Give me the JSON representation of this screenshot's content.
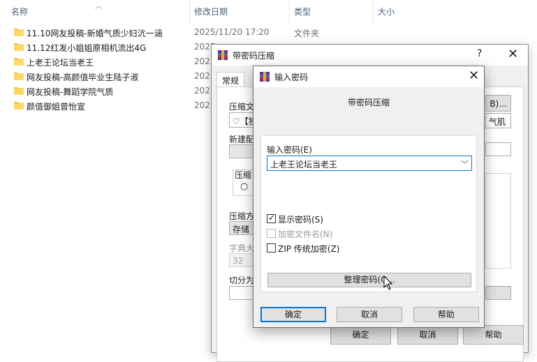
{
  "explorer": {
    "columns": {
      "name": "名称",
      "modified": "修改日期",
      "type": "类型",
      "size": "大小"
    },
    "rows": [
      {
        "name": "11.10网友投稿-新婚气质少妇沆一涵",
        "date": "2025/11/20 17:20",
        "type": "文件夹"
      },
      {
        "name": "11.12红发小姐姐原相机流出4G",
        "date": "2025",
        "type": ""
      },
      {
        "name": "上老王论坛当老王",
        "date": "2025",
        "type": ""
      },
      {
        "name": "网友投稿-高颜值毕业生陆子淑",
        "date": "2025",
        "type": ""
      },
      {
        "name": "网友投稿-舞蹈学院气质",
        "date": "2025",
        "type": ""
      },
      {
        "name": "颜值御姐曾怡宣",
        "date": "2025",
        "type": ""
      }
    ],
    "folder_color": "#f5c542"
  },
  "back_dialog": {
    "title": "带密码压缩",
    "help_glyph": "?",
    "close_glyph": "✕",
    "tabs": [
      "常规"
    ],
    "archive_label": "压缩文",
    "archive_value": "♡【独",
    "browse_label": "B)...",
    "profile_value": "气肌",
    "new_profile_label": "新建配",
    "format_label": "压缩",
    "radio_glyph": "○",
    "method_label": "压缩方",
    "method_value": "存储",
    "dict_label": "字典大",
    "dict_value": "32",
    "split_label": "切分为",
    "ok_label": "确定",
    "cancel_label": "取消",
    "help_label": "帮助"
  },
  "front_dialog": {
    "title": "输入密码",
    "close_glyph": "✕",
    "subtitle": "带密码压缩",
    "password_label": "输入密码(E)",
    "password_value": "上老王论坛当老王",
    "show_password": "显示密码(S)",
    "encrypt_names": "加密文件名(N)",
    "zip_legacy": "ZIP 传统加密(Z)",
    "organize_label": "整理密码(O...",
    "ok_label": "确定",
    "cancel_label": "取消",
    "help_label": "帮助",
    "show_password_checked": true,
    "encrypt_names_checked": false,
    "zip_legacy_checked": false
  }
}
